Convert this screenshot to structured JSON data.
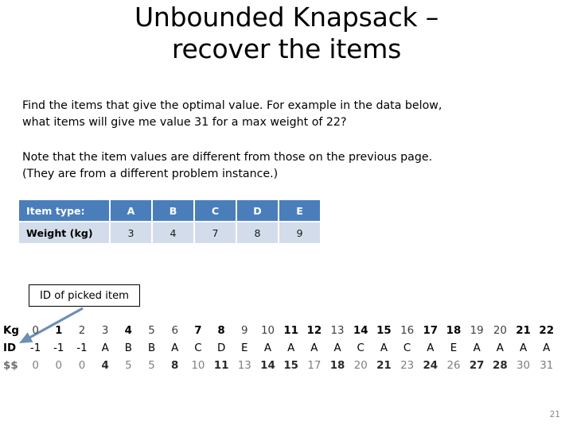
{
  "slide": {
    "title_lines": [
      "Unbounded Knapsack –",
      "recover the items"
    ],
    "page_number": "21"
  },
  "body": {
    "question_lines": [
      "Find the items that give the optimal value. For example in the data below,",
      "what items will give me value 31 for a max weight of 22?"
    ],
    "note_lines": [
      "Note that the item values are different from those on the previous page.",
      "(They are from a different problem instance.)"
    ]
  },
  "item_table": {
    "header_label": "Item type:",
    "item_types": [
      "A",
      "B",
      "C",
      "D",
      "E"
    ],
    "weight_label": "Weight (kg)",
    "weights": [
      "3",
      "4",
      "7",
      "8",
      "9"
    ],
    "header_bg": "#4a7ebb",
    "header_fg": "#ffffff",
    "data_bg": "#d3dcea"
  },
  "callout": {
    "label": "ID of picked item",
    "arrow_color": "#6e8fb5"
  },
  "dp_table": {
    "row_labels": {
      "kg": "Kg",
      "id": "ID",
      "value": "$$"
    },
    "kg": [
      "0",
      "1",
      "2",
      "3",
      "4",
      "5",
      "6",
      "7",
      "8",
      "9",
      "10",
      "11",
      "12",
      "13",
      "14",
      "15",
      "16",
      "17",
      "18",
      "19",
      "20",
      "21",
      "22"
    ],
    "kg_bold": [
      false,
      true,
      false,
      false,
      true,
      false,
      false,
      true,
      true,
      false,
      false,
      true,
      true,
      false,
      true,
      true,
      false,
      true,
      true,
      false,
      false,
      true,
      true
    ],
    "id": [
      "-1",
      "-1",
      "-1",
      "A",
      "B",
      "B",
      "A",
      "C",
      "D",
      "E",
      "A",
      "A",
      "A",
      "A",
      "C",
      "A",
      "C",
      "A",
      "E",
      "A",
      "A",
      "A",
      "A"
    ],
    "value": [
      "0",
      "0",
      "0",
      "4",
      "5",
      "5",
      "8",
      "10",
      "11",
      "13",
      "14",
      "15",
      "17",
      "18",
      "20",
      "21",
      "23",
      "24",
      "26",
      "27",
      "28",
      "30",
      "31"
    ],
    "value_bold": [
      false,
      false,
      false,
      true,
      false,
      false,
      true,
      false,
      true,
      false,
      true,
      true,
      false,
      true,
      false,
      true,
      false,
      true,
      false,
      true,
      true,
      false,
      false
    ]
  }
}
